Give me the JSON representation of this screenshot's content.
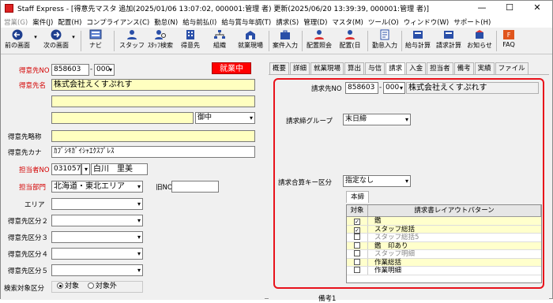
{
  "window": {
    "title": "Staff Express - [得意先マスタ 追加(2025/01/06 13:07:02, 000001:管理 者) 更新(2025/06/20 13:39:39, 000001:管理 者)]",
    "minimize": "—",
    "maximize": "☐",
    "close": "✕"
  },
  "menu": [
    {
      "label": "営業(G)",
      "dim": true
    },
    {
      "label": "案件(J)"
    },
    {
      "label": "配置(H)"
    },
    {
      "label": "コンプライアンス(C)"
    },
    {
      "label": "勤怠(N)"
    },
    {
      "label": "給与前払(I)"
    },
    {
      "label": "給与賞与年調(T)"
    },
    {
      "label": "請求(S)"
    },
    {
      "label": "管理(D)"
    },
    {
      "label": "マスタ(M)"
    },
    {
      "label": "ツール(O)"
    },
    {
      "label": "ウィンドウ(W)"
    },
    {
      "label": "サポート(H)"
    }
  ],
  "toolbar": {
    "prev": "前の画面",
    "next": "次の画面",
    "nav": "ナビ",
    "staff": "スタッフ",
    "staff_search": "ｽﾀｯﾌ検索",
    "client": "得意先",
    "org": "組織",
    "site": "就業現場",
    "case_entry": "案件入力",
    "placement_check": "配置照会",
    "placement_day": "配置(日",
    "attendance_entry": "勤怠入力",
    "payroll_calc": "給与計算",
    "billing_calc": "請求計算",
    "notice": "お知らせ",
    "faq": "FAQ"
  },
  "form": {
    "client_no_label": "得意先NO",
    "client_no": "858603",
    "client_branch": "000",
    "status_badge": "就業中",
    "client_name_label": "得意先名",
    "client_name": "株式会社えくすぷれす",
    "client_name2": "",
    "client_name3": "",
    "honorific": "御中",
    "short_name_label": "得意先略称",
    "short_name": "",
    "kana_label": "得意先カナ",
    "kana": "ｶﾌﾞｼｷｶﾞｲｼｬｴｸｽﾌﾟﾚｽ",
    "staff_no_label": "担当者NO",
    "staff_no": "031057",
    "staff_name": "白川　里美",
    "dept_label": "担当部門",
    "dept": "北海道・東北エリア",
    "old_no_label": "旧NO",
    "old_no": "",
    "area_label": "エリア",
    "area": "",
    "class2_label": "得意先区分２",
    "class3_label": "得意先区分３",
    "class4_label": "得意先区分４",
    "class5_label": "得意先区分５",
    "search_label": "検索対象区分",
    "opt_target": "対象",
    "opt_excluded": "対象外"
  },
  "tabs": [
    "概要",
    "詳細",
    "就業現場",
    "算出",
    "与信",
    "請求",
    "入金",
    "担当者",
    "備考",
    "実績",
    "ファイル"
  ],
  "billing": {
    "bill_to_label": "請求先NO",
    "bill_to_no": "858603",
    "bill_to_branch": "000",
    "bill_to_name": "株式会社えくすぷれす",
    "group_label": "請求締グループ",
    "group": "末日締",
    "combine_label": "請求合算キー区分",
    "combine": "指定なし",
    "subtab": "本締",
    "grid_col_target": "対象",
    "grid_col_pattern": "請求書レイアウトパターン",
    "rows": [
      {
        "checked": true,
        "name": "鑑",
        "hl": true,
        "grey": false
      },
      {
        "checked": true,
        "name": "スタッフ総括",
        "hl": true,
        "grey": false
      },
      {
        "checked": false,
        "name": "スタッフ総括5",
        "hl": false,
        "grey": true
      },
      {
        "checked": false,
        "name": "鑑　印あり",
        "hl": true,
        "grey": false
      },
      {
        "checked": false,
        "name": "スタッフ明細",
        "hl": false,
        "grey": true
      },
      {
        "checked": false,
        "name": "作業総括",
        "hl": true,
        "grey": false
      },
      {
        "checked": false,
        "name": "作業明細",
        "hl": false,
        "grey": false
      }
    ],
    "note_label": "備考1"
  },
  "colors": {
    "highlight_border": "#e8121b",
    "required_label": "#d40000",
    "yellow_field": "#ffffc0",
    "badge": "#ff0000"
  }
}
